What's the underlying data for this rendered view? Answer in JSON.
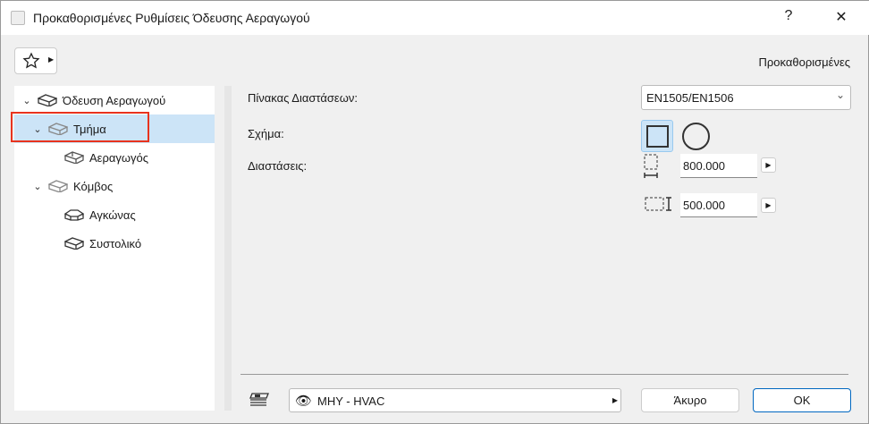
{
  "window": {
    "title": "Προκαθορισμένες Ρυθμίσεις Όδευσης Αεραγωγού",
    "help": "?",
    "close": "✕"
  },
  "header": {
    "favorites_icon": "star-icon",
    "preset_label": "Προκαθορισμένες"
  },
  "tree": [
    {
      "label": "Όδευση Αεραγωγού",
      "level": 0,
      "expanded": true
    },
    {
      "label": "Τμήμα",
      "level": 1,
      "expanded": true,
      "selected": true
    },
    {
      "label": "Αεραγωγός",
      "level": 2
    },
    {
      "label": "Κόμβος",
      "level": 1,
      "expanded": true
    },
    {
      "label": "Αγκώνας",
      "level": 2
    },
    {
      "label": "Συστολικό",
      "level": 2
    }
  ],
  "settings": {
    "table_label": "Πίνακας Διαστάσεων:",
    "table_value": "EN1505/EN1506",
    "shape_label": "Σχήμα:",
    "shape_selected": "rectangle",
    "dims_label": "Διαστάσεις:",
    "width_value": "800.000",
    "height_value": "500.000"
  },
  "footer": {
    "layer_value": "MHY - HVAC",
    "cancel": "Άκυρο",
    "ok": "OK"
  },
  "colors": {
    "selection": "#cce4f7",
    "highlight_box": "#e8331e"
  }
}
